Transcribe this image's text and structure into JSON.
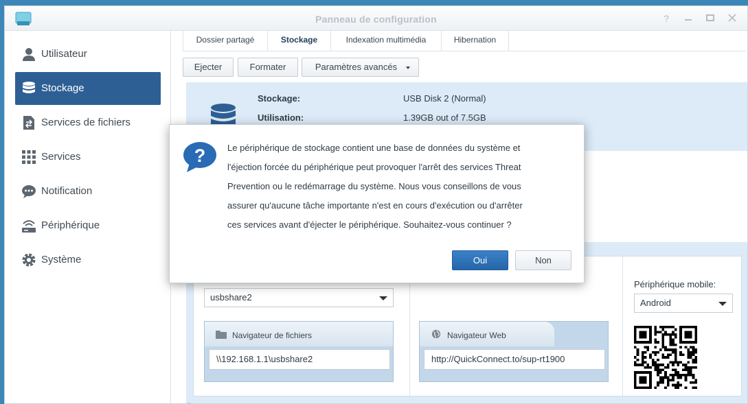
{
  "window": {
    "title": "Panneau de configuration",
    "controls": [
      "help-icon",
      "minimize-icon",
      "maximize-icon",
      "close-icon"
    ]
  },
  "sidebar": {
    "items": [
      {
        "label": "Utilisateur",
        "icon": "user-icon",
        "active": false
      },
      {
        "label": "Stockage",
        "icon": "database-icon",
        "active": true
      },
      {
        "label": "Services de fichiers",
        "icon": "file-services-icon",
        "active": false
      },
      {
        "label": "Services",
        "icon": "grid-icon",
        "active": false
      },
      {
        "label": "Notification",
        "icon": "chat-bubble-icon",
        "active": false
      },
      {
        "label": "Périphérique",
        "icon": "router-icon",
        "active": false
      },
      {
        "label": "Système",
        "icon": "gear-icon",
        "active": false
      }
    ]
  },
  "tabs": [
    {
      "label": "Dossier partagé",
      "active": false
    },
    {
      "label": "Stockage",
      "active": true
    },
    {
      "label": "Indexation multimédia",
      "active": false
    },
    {
      "label": "Hibernation",
      "active": false
    }
  ],
  "toolbar": {
    "eject_label": "Ejecter",
    "format_label": "Formater",
    "advanced_label": "Paramètres avancés"
  },
  "storage_info": {
    "storage_key": "Stockage:",
    "storage_value": "USB Disk 2 (Normal)",
    "usage_key": "Utilisation:",
    "usage_value": "1.39GB out of 7.5GB"
  },
  "share": {
    "share_select": "usbshare2",
    "file_browser_label": "Navigateur de fichiers",
    "file_browser_path": "\\\\192.168.1.1\\usbshare2",
    "web_browser_label": "Navigateur Web",
    "web_browser_url": "http://QuickConnect.to/sup-rt1900",
    "mobile_label": "Périphérique mobile:",
    "mobile_select": "Android"
  },
  "dialog": {
    "lines": [
      "Le périphérique de stockage contient une base de données du système et",
      "l'éjection forcée du périphérique peut provoquer l'arrêt des services Threat",
      "Prevention ou le redémarrage du système. Nous vous conseillons de vous",
      "assurer qu'aucune tâche importante n'est en cours d'exécution ou d'arrêter",
      "ces services avant d'éjecter le périphérique. Souhaitez-vous continuer ?"
    ],
    "yes_label": "Oui",
    "no_label": "Non"
  },
  "colors": {
    "accent": "#2e5f94",
    "panel": "#dcebf7",
    "primary_button": "#2e6fb6"
  }
}
